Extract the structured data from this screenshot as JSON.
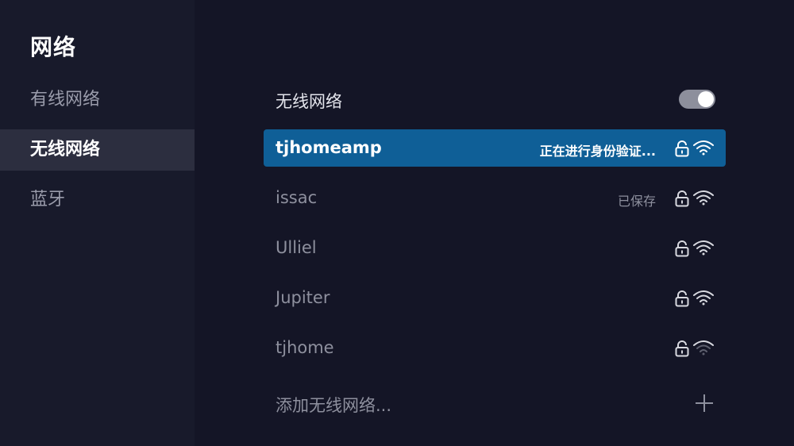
{
  "sidebar": {
    "title": "网络",
    "items": [
      {
        "label": "有线网络"
      },
      {
        "label": "无线网络"
      },
      {
        "label": "蓝牙"
      }
    ]
  },
  "wifi_toggle": {
    "label": "无线网络",
    "state": "on"
  },
  "networks": [
    {
      "name": "tjhomeamp",
      "status": "正在进行身份验证...",
      "signal": "full",
      "locked": true,
      "selected": true
    },
    {
      "name": "issac",
      "status": "已保存",
      "signal": "full",
      "locked": true
    },
    {
      "name": "Ulliel",
      "status": "",
      "signal": "full",
      "locked": true
    },
    {
      "name": "Jupiter",
      "status": "",
      "signal": "full",
      "locked": true
    },
    {
      "name": "tjhome",
      "status": "",
      "signal": "weak",
      "locked": true
    }
  ],
  "add_network": {
    "label": "添加无线网络...",
    "icon": "plus-icon"
  },
  "colors": {
    "background": "#141526",
    "sidebar": "#181a2b",
    "sidebar_active": "#2c2e3f",
    "selected_row": "#0f5f97",
    "muted_text": "#8e909e",
    "toggle_track": "#8d8f9c"
  }
}
